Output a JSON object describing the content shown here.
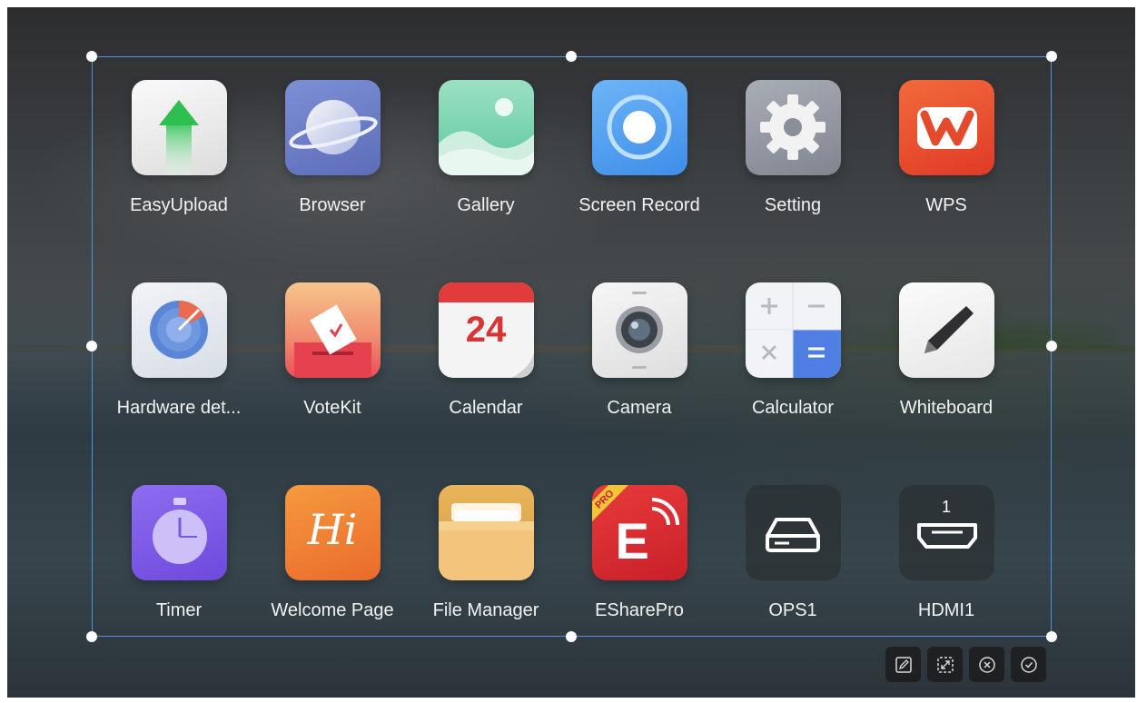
{
  "apps": [
    {
      "label": "EasyUpload",
      "icon": "easyupload-icon"
    },
    {
      "label": "Browser",
      "icon": "browser-icon"
    },
    {
      "label": "Gallery",
      "icon": "gallery-icon"
    },
    {
      "label": "Screen Record",
      "icon": "screen-record-icon"
    },
    {
      "label": "Setting",
      "icon": "gear-icon"
    },
    {
      "label": "WPS",
      "icon": "wps-icon"
    },
    {
      "label": "Hardware det...",
      "icon": "hardware-detection-icon"
    },
    {
      "label": "VoteKit",
      "icon": "votekit-icon"
    },
    {
      "label": "Calendar",
      "icon": "calendar-icon",
      "day": "24"
    },
    {
      "label": "Camera",
      "icon": "camera-icon"
    },
    {
      "label": "Calculator",
      "icon": "calculator-icon"
    },
    {
      "label": "Whiteboard",
      "icon": "whiteboard-icon"
    },
    {
      "label": "Timer",
      "icon": "timer-icon"
    },
    {
      "label": "Welcome Page",
      "icon": "welcome-page-icon",
      "glyph": "Hi"
    },
    {
      "label": "File Manager",
      "icon": "folder-icon"
    },
    {
      "label": "ESharePro",
      "icon": "esharepro-icon",
      "badge": "PRO",
      "letter": "E"
    },
    {
      "label": "OPS1",
      "icon": "ops-icon"
    },
    {
      "label": "HDMI1",
      "icon": "hdmi-icon",
      "port_number": "1"
    }
  ],
  "toolbar": [
    {
      "icon": "edit-icon"
    },
    {
      "icon": "resize-icon"
    },
    {
      "icon": "close-circle-icon"
    },
    {
      "icon": "check-circle-icon"
    }
  ],
  "colors": {
    "selection_border": "#4f93d8",
    "label": "#f2f2f2"
  }
}
